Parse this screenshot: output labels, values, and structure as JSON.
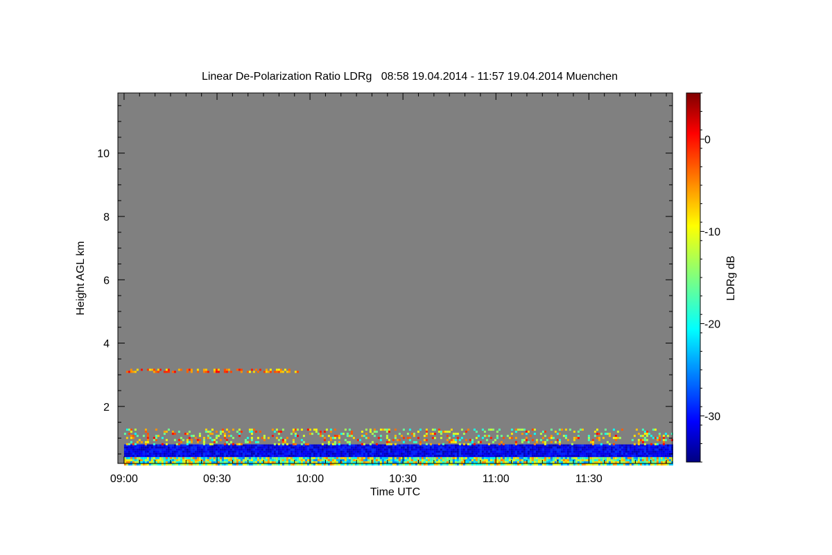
{
  "chart_data": {
    "type": "heatmap",
    "title": "Linear De-Polarization Ratio LDRg   08:58 19.04.2014 - 11:57 19.04.2014 Muenchen",
    "xlabel": "Time UTC",
    "ylabel": "Height AGL km",
    "colorbar_label": "LDRg dB",
    "x_range_minutes_utc": [
      538,
      717
    ],
    "x_tick_minutes_utc": [
      540,
      570,
      600,
      630,
      660,
      690
    ],
    "x_tick_labels": [
      "09:00",
      "09:30",
      "10:00",
      "10:30",
      "11:00",
      "11:30"
    ],
    "ylim": [
      0.2,
      11.9
    ],
    "y_ticks": [
      2,
      4,
      6,
      8,
      10
    ],
    "y_tick_labels": [
      "2",
      "4",
      "6",
      "8",
      "10"
    ],
    "colorbar_range": [
      -35,
      5
    ],
    "colorbar_ticks": [
      0,
      -10,
      -20,
      -30
    ],
    "colorbar_tick_labels": [
      "0",
      "-10",
      "-20",
      "-30"
    ],
    "colormap": "jet",
    "background_color": "#808080",
    "layers": [
      {
        "feature": "thin elevated depolarizing layer",
        "height_km": 3.15,
        "time_utc": [
          "09:00",
          "09:57"
        ],
        "ldr_db": [
          -10,
          0
        ]
      },
      {
        "feature": "low depolarization aerosol band",
        "height_km": [
          0.4,
          0.8
        ],
        "time_utc": [
          "09:00",
          "11:57"
        ],
        "ldr_db": [
          -33,
          -28
        ]
      },
      {
        "feature": "surface layer mixture",
        "height_km": [
          0.2,
          0.4
        ],
        "time_utc": [
          "09:00",
          "11:57"
        ],
        "ldr_db": [
          -25,
          -5
        ]
      },
      {
        "feature": "boundary layer top scatter",
        "height_km": [
          0.8,
          1.3
        ],
        "time_utc": [
          "09:00",
          "11:57"
        ],
        "ldr_db": [
          -20,
          0
        ]
      }
    ]
  },
  "colors": {
    "panel_background": "#808080",
    "page_background": "#ffffff"
  }
}
